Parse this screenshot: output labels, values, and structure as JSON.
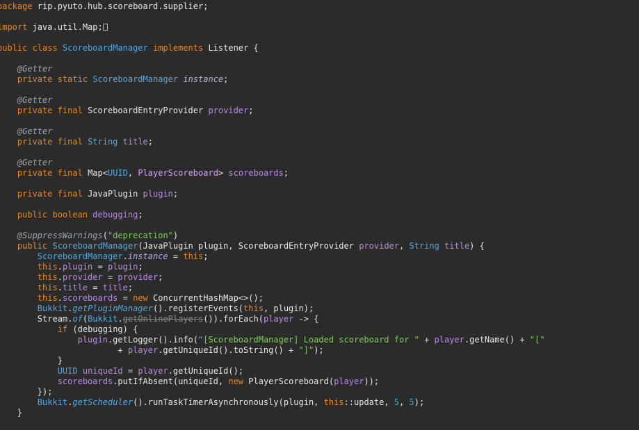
{
  "editor": {
    "language": "java",
    "colors": {
      "background": "#2b2b2b",
      "keyword": "#e1892a",
      "type": "#55a7e0",
      "string": "#84c964",
      "annotation": "#9ea6ad",
      "number": "#3fa9bd",
      "field": "#b78de0"
    },
    "lines": [
      [
        [
          "keyword",
          "package"
        ],
        [
          "plain",
          " rip.pyuto.hub.scoreboard.supplier;"
        ]
      ],
      [],
      [
        [
          "keyword",
          "import"
        ],
        [
          "plain",
          " java.util.Map;"
        ],
        [
          "fold",
          ""
        ]
      ],
      [],
      [
        [
          "keyword",
          "public class "
        ],
        [
          "type",
          "ScoreboardManager"
        ],
        [
          "keyword",
          " implements "
        ],
        [
          "plain",
          "Listener {"
        ]
      ],
      [],
      [
        [
          "plain",
          "    "
        ],
        [
          "annotation",
          "@Getter"
        ]
      ],
      [
        [
          "plain",
          "    "
        ],
        [
          "keyword",
          "private static "
        ],
        [
          "type",
          "ScoreboardManager"
        ],
        [
          "plain",
          " "
        ],
        [
          "ifield",
          "instance"
        ],
        [
          "plain",
          ";"
        ]
      ],
      [],
      [
        [
          "plain",
          "    "
        ],
        [
          "annotation",
          "@Getter"
        ]
      ],
      [
        [
          "plain",
          "    "
        ],
        [
          "keyword",
          "private final "
        ],
        [
          "plain",
          "ScoreboardEntryProvider "
        ],
        [
          "field",
          "provider"
        ],
        [
          "plain",
          ";"
        ]
      ],
      [],
      [
        [
          "plain",
          "    "
        ],
        [
          "annotation",
          "@Getter"
        ]
      ],
      [
        [
          "plain",
          "    "
        ],
        [
          "keyword",
          "private final "
        ],
        [
          "type",
          "String"
        ],
        [
          "plain",
          " "
        ],
        [
          "field",
          "title"
        ],
        [
          "plain",
          ";"
        ]
      ],
      [],
      [
        [
          "plain",
          "    "
        ],
        [
          "annotation",
          "@Getter"
        ]
      ],
      [
        [
          "plain",
          "    "
        ],
        [
          "keyword",
          "private final "
        ],
        [
          "plain",
          "Map<"
        ],
        [
          "type",
          "UUID"
        ],
        [
          "plain",
          ", "
        ],
        [
          "enum",
          "PlayerScoreboard"
        ],
        [
          "plain",
          "> "
        ],
        [
          "field",
          "scoreboards"
        ],
        [
          "plain",
          ";"
        ]
      ],
      [],
      [
        [
          "plain",
          "    "
        ],
        [
          "keyword",
          "private final "
        ],
        [
          "plain",
          "JavaPlugin "
        ],
        [
          "field",
          "plugin"
        ],
        [
          "plain",
          ";"
        ]
      ],
      [],
      [
        [
          "plain",
          "    "
        ],
        [
          "keyword",
          "public boolean "
        ],
        [
          "field",
          "debugging"
        ],
        [
          "plain",
          ";"
        ]
      ],
      [],
      [
        [
          "plain",
          "    "
        ],
        [
          "annotation",
          "@SuppressWarnings"
        ],
        [
          "plain",
          "("
        ],
        [
          "string",
          "\"deprecation\""
        ],
        [
          "plain",
          ")"
        ]
      ],
      [
        [
          "plain",
          "    "
        ],
        [
          "keyword",
          "public "
        ],
        [
          "type",
          "ScoreboardManager"
        ],
        [
          "plain",
          "(JavaPlugin plugin, ScoreboardEntryProvider "
        ],
        [
          "field",
          "provider"
        ],
        [
          "plain",
          ", "
        ],
        [
          "type",
          "String"
        ],
        [
          "plain",
          " "
        ],
        [
          "field",
          "title"
        ],
        [
          "plain",
          ") {"
        ]
      ],
      [
        [
          "plain",
          "        "
        ],
        [
          "type",
          "ScoreboardManager"
        ],
        [
          "plain",
          "."
        ],
        [
          "ifield",
          "instance"
        ],
        [
          "plain",
          " = "
        ],
        [
          "keyword",
          "this"
        ],
        [
          "plain",
          ";"
        ]
      ],
      [
        [
          "plain",
          "        "
        ],
        [
          "keyword",
          "this"
        ],
        [
          "plain",
          "."
        ],
        [
          "field",
          "plugin"
        ],
        [
          "plain",
          " = "
        ],
        [
          "field",
          "plugin"
        ],
        [
          "plain",
          ";"
        ]
      ],
      [
        [
          "plain",
          "        "
        ],
        [
          "keyword",
          "this"
        ],
        [
          "plain",
          "."
        ],
        [
          "field",
          "provider"
        ],
        [
          "plain",
          " = "
        ],
        [
          "field",
          "provider"
        ],
        [
          "plain",
          ";"
        ]
      ],
      [
        [
          "plain",
          "        "
        ],
        [
          "keyword",
          "this"
        ],
        [
          "plain",
          "."
        ],
        [
          "field",
          "title"
        ],
        [
          "plain",
          " = "
        ],
        [
          "field",
          "title"
        ],
        [
          "plain",
          ";"
        ]
      ],
      [
        [
          "plain",
          "        "
        ],
        [
          "keyword",
          "this"
        ],
        [
          "plain",
          "."
        ],
        [
          "field",
          "scoreboards"
        ],
        [
          "plain",
          " = "
        ],
        [
          "keyword",
          "new "
        ],
        [
          "plain",
          "ConcurrentHashMap<>();"
        ]
      ],
      [
        [
          "plain",
          "        "
        ],
        [
          "type",
          "Bukkit"
        ],
        [
          "plain",
          "."
        ],
        [
          "static",
          "getPluginManager"
        ],
        [
          "plain",
          "().registerEvents("
        ],
        [
          "keyword",
          "this"
        ],
        [
          "plain",
          ", plugin);"
        ]
      ],
      [
        [
          "plain",
          "        Stream."
        ],
        [
          "static",
          "of"
        ],
        [
          "plain",
          "("
        ],
        [
          "type",
          "Bukkit"
        ],
        [
          "plain",
          "."
        ],
        [
          "deprecated",
          "getOnlinePlayers"
        ],
        [
          "plain",
          "()).forEach("
        ],
        [
          "field",
          "player"
        ],
        [
          "plain",
          " -> {"
        ]
      ],
      [
        [
          "plain",
          "            "
        ],
        [
          "keyword",
          "if "
        ],
        [
          "plain",
          "(debugging) {"
        ]
      ],
      [
        [
          "plain",
          "                "
        ],
        [
          "field",
          "plugin"
        ],
        [
          "plain",
          ".getLogger().info("
        ],
        [
          "string",
          "\"[ScoreboardManager] Loaded scoreboard for \""
        ],
        [
          "plain",
          " + "
        ],
        [
          "field",
          "player"
        ],
        [
          "plain",
          ".getName() + "
        ],
        [
          "string",
          "\"[\""
        ]
      ],
      [
        [
          "plain",
          "                        + "
        ],
        [
          "field",
          "player"
        ],
        [
          "plain",
          ".getUniqueId().toString() + "
        ],
        [
          "string",
          "\"]\""
        ],
        [
          "plain",
          ");"
        ]
      ],
      [
        [
          "plain",
          "            }"
        ]
      ],
      [
        [
          "plain",
          "            "
        ],
        [
          "type",
          "UUID"
        ],
        [
          "plain",
          " "
        ],
        [
          "field",
          "uniqueId"
        ],
        [
          "plain",
          " = "
        ],
        [
          "field",
          "player"
        ],
        [
          "plain",
          ".getUniqueId();"
        ]
      ],
      [
        [
          "plain",
          "            "
        ],
        [
          "field",
          "scoreboards"
        ],
        [
          "plain",
          ".putIfAbsent(uniqueId, "
        ],
        [
          "keyword",
          "new "
        ],
        [
          "plain",
          "PlayerScoreboard("
        ],
        [
          "field",
          "player"
        ],
        [
          "plain",
          "));"
        ]
      ],
      [
        [
          "plain",
          "        });"
        ]
      ],
      [
        [
          "plain",
          "        "
        ],
        [
          "type",
          "Bukkit"
        ],
        [
          "plain",
          "."
        ],
        [
          "static",
          "getScheduler"
        ],
        [
          "plain",
          "().runTaskTimerAsynchronously(plugin, "
        ],
        [
          "keyword",
          "this"
        ],
        [
          "plain",
          "::update, "
        ],
        [
          "number",
          "5"
        ],
        [
          "plain",
          ", "
        ],
        [
          "number",
          "5"
        ],
        [
          "plain",
          ");"
        ]
      ],
      [
        [
          "plain",
          "    }"
        ]
      ]
    ]
  }
}
